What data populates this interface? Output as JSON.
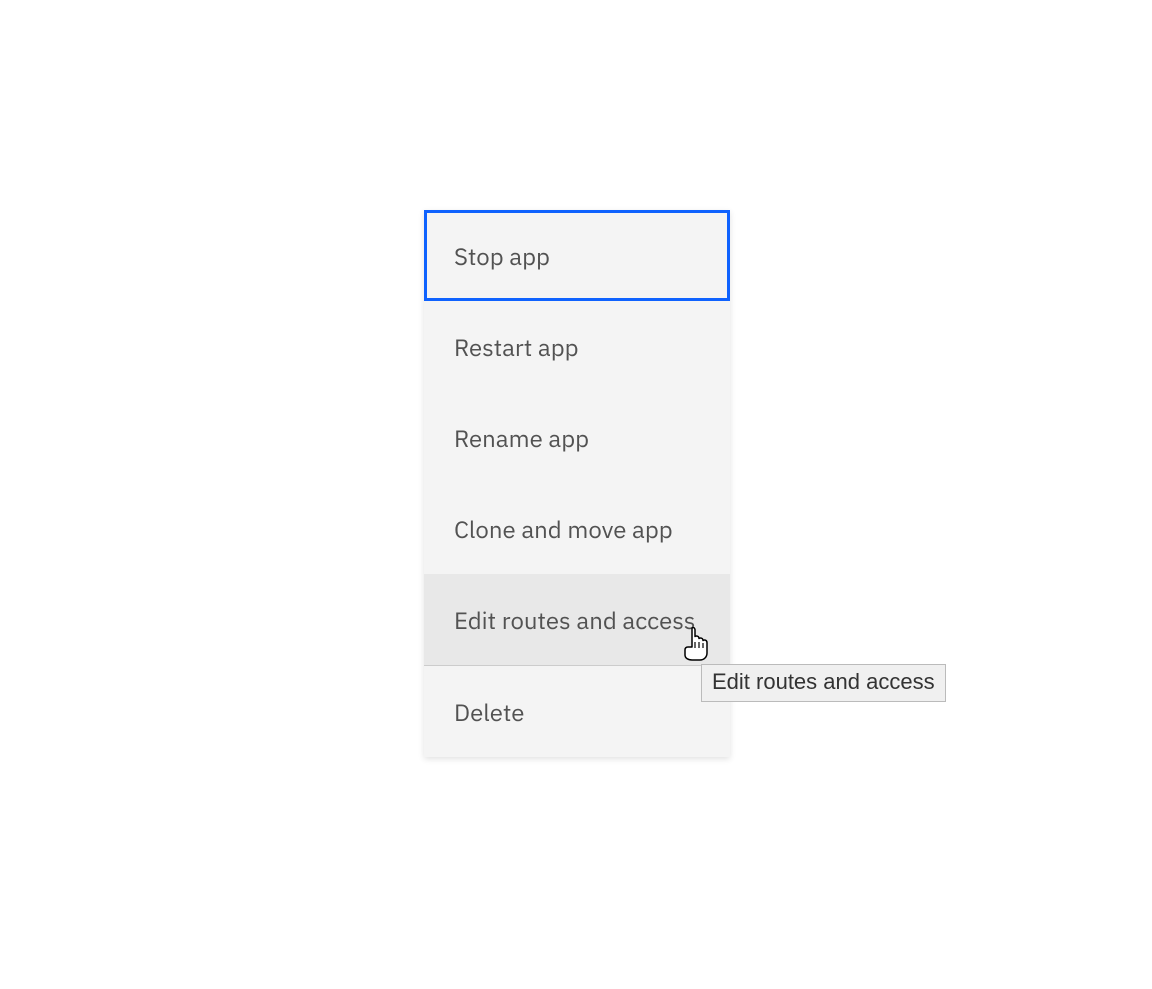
{
  "menu": {
    "items": [
      {
        "label": "Stop app",
        "focused": true,
        "hovered": false,
        "name": "menu-item-stop-app"
      },
      {
        "label": "Restart app",
        "focused": false,
        "hovered": false,
        "name": "menu-item-restart-app"
      },
      {
        "label": "Rename app",
        "focused": false,
        "hovered": false,
        "name": "menu-item-rename-app"
      },
      {
        "label": "Clone and move app",
        "focused": false,
        "hovered": false,
        "name": "menu-item-clone-move-app"
      },
      {
        "label": "Edit routes and access",
        "focused": false,
        "hovered": true,
        "name": "menu-item-edit-routes-access"
      },
      {
        "label": "Delete",
        "focused": false,
        "hovered": false,
        "name": "menu-item-delete"
      }
    ]
  },
  "tooltip": {
    "text": "Edit routes and access"
  },
  "colors": {
    "focus": "#0f62fe",
    "menuBg": "#f4f4f4",
    "hoverBg": "#e8e8e8",
    "text": "#525252"
  }
}
